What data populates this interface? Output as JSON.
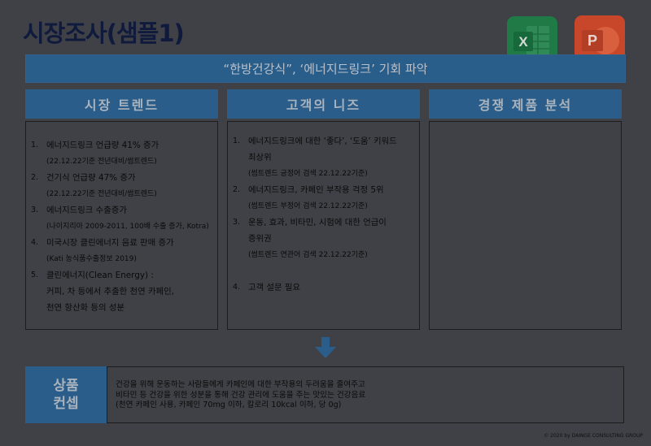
{
  "title": "시장조사(샘플1)",
  "icons": {
    "excel": {
      "label": "X",
      "color": "#1f7a45"
    },
    "powerpoint": {
      "label": "P",
      "color": "#c8472a"
    }
  },
  "banner": "“한방건강식”, ‘에너지드링크’ 기회 파악",
  "columns": [
    {
      "header": "시장 트렌드",
      "items": [
        {
          "num": "1.",
          "lines": [
            "에너지드링크 언급량 41% 증가",
            "(22.12.22기준 전년대비/썸트렌드)"
          ]
        },
        {
          "num": "2.",
          "lines": [
            "건기식 언급량 47% 증가",
            "(22.12.22기준 전년대비/썸트렌드)"
          ]
        },
        {
          "num": "3.",
          "lines": [
            "에너지드링크 수출증가",
            "(나이지리아 2009-2011, 100배 수출 증가, Kotra)"
          ]
        },
        {
          "num": "4.",
          "lines": [
            "미국시장 클린에너지 음료 판매 증가",
            "(Kati 농식품수출정보 2019)"
          ]
        },
        {
          "num": "5.",
          "lines": [
            "클린에너지(Clean Energy) :",
            "커피, 차 등에서 추출한 천연 카페인,",
            "천연 항산화 등의 성분"
          ]
        }
      ]
    },
    {
      "header": "고객의 니즈",
      "items": [
        {
          "num": "1.",
          "lines": [
            "에너지드링크에 대한 ‘좋다’, ‘도움’ 키워드",
            "최상위",
            "(썸트렌드 긍정어 검색 22.12.22기준)"
          ]
        },
        {
          "num": "2.",
          "lines": [
            "에너지드링크, 카페인 부작용 걱정 5위",
            "(썸트렌드 부정어 검색 22.12.22기준)"
          ]
        },
        {
          "num": "3.",
          "lines": [
            "운동, 효과, 비타민, 시험에 대한 언급이",
            "증위권",
            "(썸트렌드 연관어 검색 22.12.22기준)"
          ]
        },
        {
          "num": "4.",
          "lines": [
            "고객 설문 필요"
          ]
        }
      ]
    },
    {
      "header": "경쟁 제품 분석",
      "items": []
    }
  ],
  "concept": {
    "label_line1": "상품",
    "label_line2": "컨셉",
    "lines": [
      "건강을 위해 운동하는 사람들에게 카페인에 대한 부작용의 두려움을 줄여주고",
      "비타민 등 건강을 위한 성분을 통해 건강 관리에 도움을 주는 맛있는 건강음료",
      "(천연 카페인 사용, 카페인 70mg 이하, 칼로리 10kcal 이하, 당 0g)"
    ]
  },
  "copyright": "© 2020 by DAINGE CONSULTING GROUP"
}
